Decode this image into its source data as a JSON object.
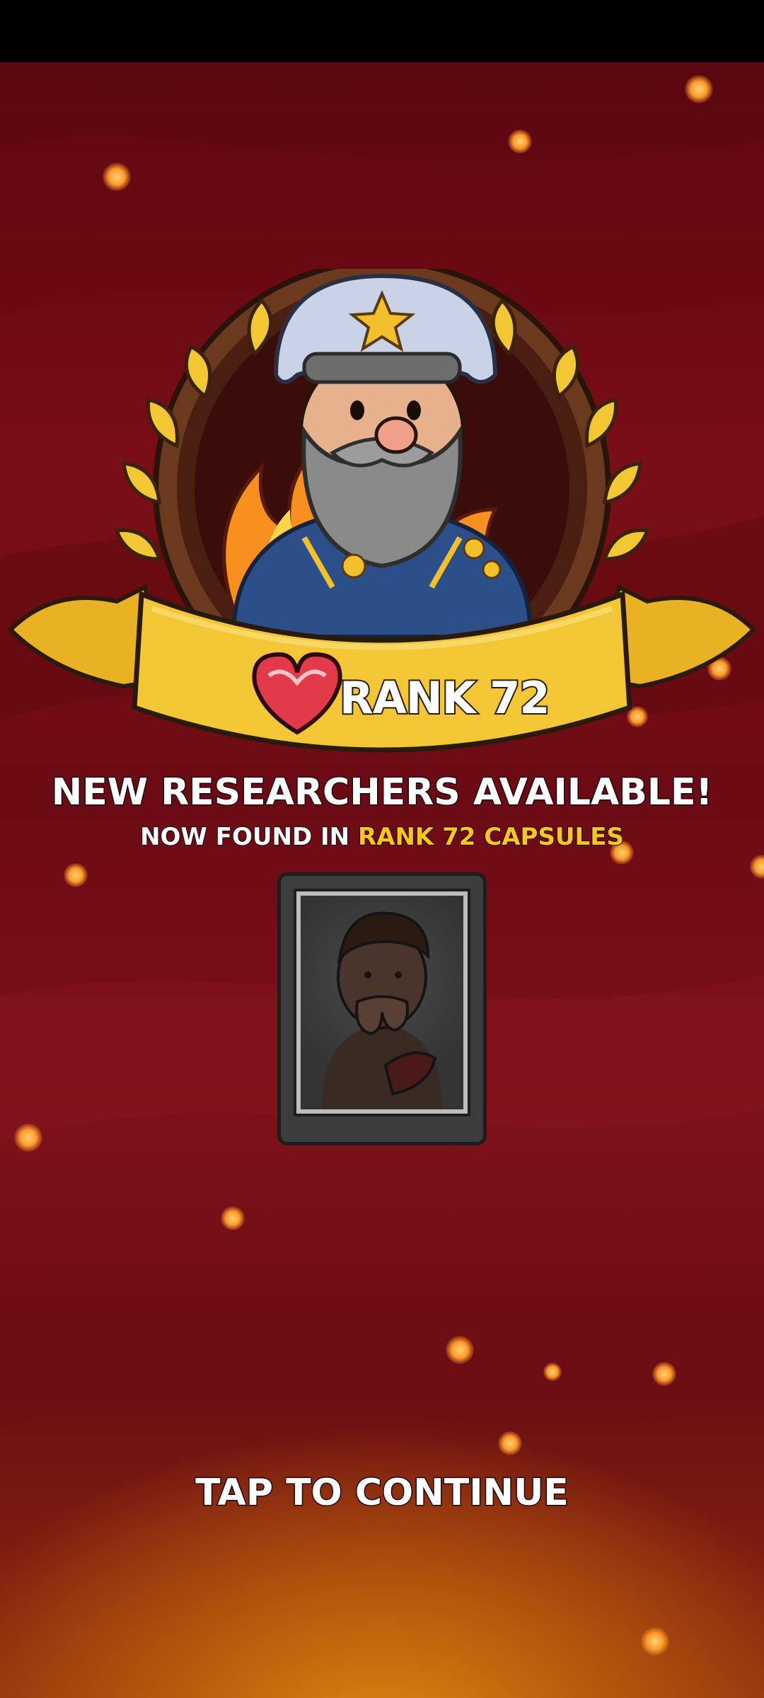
{
  "rank_badge": {
    "label": "RANK 72",
    "icon": "winged-heart-icon",
    "portrait": "general-portrait"
  },
  "announcement": {
    "headline": "NEW RESEARCHERS AVAILABLE!",
    "sub_prefix": "NOW FOUND IN ",
    "sub_highlight": "RANK 72 CAPSULES"
  },
  "researcher_card": {
    "portrait": "researcher-silhouette"
  },
  "continue_prompt": "TAP TO CONTINUE",
  "colors": {
    "background": "#7a0e16",
    "highlight": "#f5c71e",
    "gold": "#f2c02a",
    "text": "#ffffff"
  }
}
